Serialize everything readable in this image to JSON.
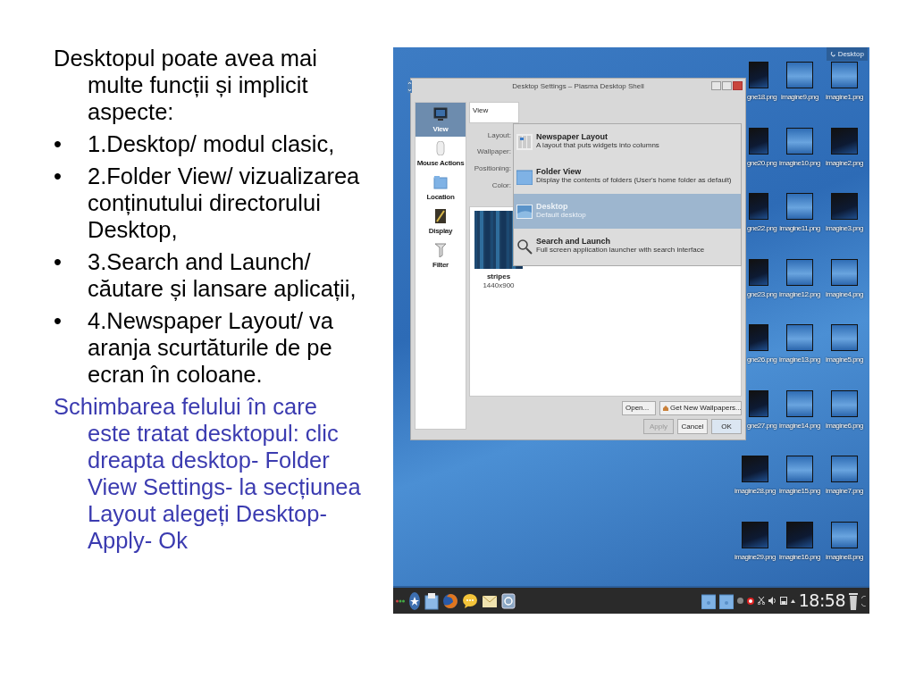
{
  "slide": {
    "intro": "Desktopul poate avea mai multe funcții și implicit aspecte:",
    "bullets": [
      {
        "marker": "•",
        "text": "1.Desktop/ modul clasic,"
      },
      {
        "marker": "•",
        "text": "2.Folder View/ vizualizarea conținutului directorului Desktop,"
      },
      {
        "marker": "•",
        "text": "3.Search and Launch/ căutare și lansare aplicații,"
      },
      {
        "marker": "•",
        "text": "4.Newspaper Layout/ va aranja scurtăturile de pe ecran în coloane."
      }
    ],
    "note": "Schimbarea felului în care este tratat desktopul: clic dreapta desktop- Folder View Settings- la secțiunea Layout alegeți Desktop- Apply- Ok"
  },
  "screenshot": {
    "desktop_label": "Desktop",
    "icons": [
      {
        "label": "gne18.png",
        "kind": "dark",
        "partly_hidden": true
      },
      {
        "label": "imagine9.png",
        "kind": "blue",
        "partly_hidden": false
      },
      {
        "label": "imagine1.png",
        "kind": "blue",
        "partly_hidden": false
      },
      {
        "label": "gne20.png",
        "kind": "dark",
        "partly_hidden": true
      },
      {
        "label": "imagine10.png",
        "kind": "blue",
        "partly_hidden": false
      },
      {
        "label": "imagine2.png",
        "kind": "dark",
        "partly_hidden": false
      },
      {
        "label": "gne22.png",
        "kind": "dark",
        "partly_hidden": true
      },
      {
        "label": "imagine11.png",
        "kind": "blue",
        "partly_hidden": false
      },
      {
        "label": "imagine3.png",
        "kind": "dark",
        "partly_hidden": false
      },
      {
        "label": "gne23.png",
        "kind": "dark",
        "partly_hidden": true
      },
      {
        "label": "imagine12.png",
        "kind": "blue",
        "partly_hidden": false
      },
      {
        "label": "imagine4.png",
        "kind": "blue",
        "partly_hidden": false
      },
      {
        "label": "gne26.png",
        "kind": "dark",
        "partly_hidden": true
      },
      {
        "label": "imagine13.png",
        "kind": "blue",
        "partly_hidden": false
      },
      {
        "label": "imagine5.png",
        "kind": "blue",
        "partly_hidden": false
      },
      {
        "label": "gne27.png",
        "kind": "dark",
        "partly_hidden": true
      },
      {
        "label": "imagine14.png",
        "kind": "blue",
        "partly_hidden": false
      },
      {
        "label": "imagine6.png",
        "kind": "blue",
        "partly_hidden": false
      },
      {
        "label": "imagine28.png",
        "kind": "dark",
        "partly_hidden": false
      },
      {
        "label": "imagine15.png",
        "kind": "blue",
        "partly_hidden": false
      },
      {
        "label": "imagine7.png",
        "kind": "blue",
        "partly_hidden": false
      },
      {
        "label": "imagine29.png",
        "kind": "dark",
        "partly_hidden": false
      },
      {
        "label": "imagine16.png",
        "kind": "dark",
        "partly_hidden": false
      },
      {
        "label": "imagine8.png",
        "kind": "blue",
        "partly_hidden": false
      }
    ],
    "window": {
      "title": "Desktop Settings – Plasma Desktop Shell",
      "sidebar": [
        {
          "label": "View",
          "kind": "monitor",
          "selected": true
        },
        {
          "label": "Mouse Actions",
          "kind": "mouse",
          "selected": false
        },
        {
          "label": "Location",
          "kind": "folder",
          "selected": false
        },
        {
          "label": "Display",
          "kind": "display",
          "selected": false
        },
        {
          "label": "Filter",
          "kind": "filter",
          "selected": false
        }
      ],
      "view_field": "View",
      "form_labels": [
        "Layout:",
        "Wallpaper:",
        "Positioning:",
        "Color:"
      ],
      "wallpapers": [
        {
          "name": "stripes",
          "size": "1440x900"
        }
      ],
      "buttons": [
        {
          "label": "Open...",
          "kind": "plain",
          "disabled": false
        },
        {
          "label": "Get New Wallpapers...",
          "kind": "download",
          "disabled": false
        }
      ],
      "dialog_buttons": [
        {
          "label": "Apply",
          "disabled": true
        },
        {
          "label": "Cancel",
          "disabled": false
        },
        {
          "label": "OK",
          "disabled": false
        }
      ]
    },
    "dropdown": [
      {
        "title": "Newspaper Layout",
        "description": "A layout that puts widgets into columns",
        "kind": "columns",
        "selected": false
      },
      {
        "title": "Folder View",
        "description": "Display the contents of folders (User's home folder as default)",
        "kind": "folder",
        "selected": false
      },
      {
        "title": "Desktop",
        "description": "Default desktop",
        "kind": "desktop",
        "selected": true
      },
      {
        "title": "Search and Launch",
        "description": "Full screen application launcher with search interface",
        "kind": "search",
        "selected": false
      }
    ],
    "taskbar": {
      "clock": "18:58"
    }
  }
}
